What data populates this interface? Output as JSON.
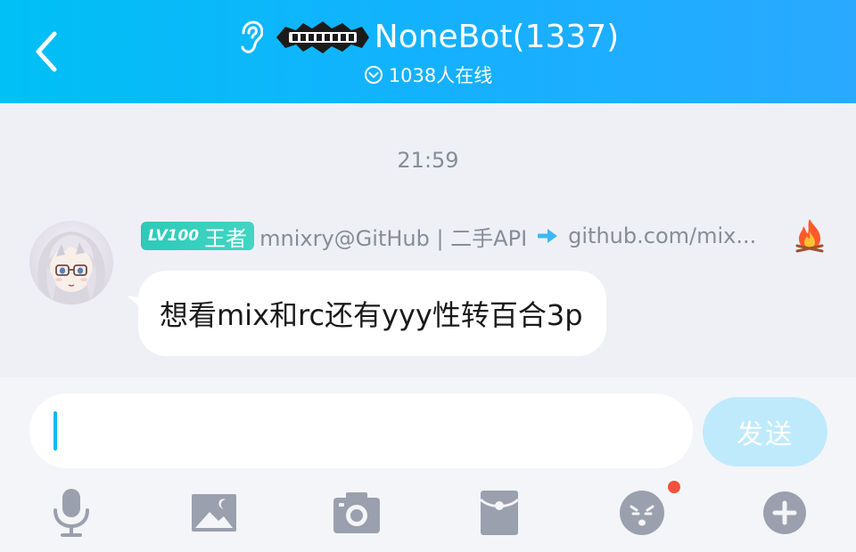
{
  "header": {
    "back_icon": "chevron-left-icon",
    "listen_icon": "ear-icon",
    "logo_icon": "group-logo-icon",
    "title": "NoneBot(1337)",
    "online_icon": "circle-chevron-down-icon",
    "online_text": "1038人在线",
    "color": "#12b7f5"
  },
  "chat": {
    "timestamp": "21:59",
    "message": {
      "avatar_icon": "anime-avatar",
      "level": "LV100",
      "rank": "王者",
      "sender": "mnixry@GitHub | 二手API",
      "arrow_icon": "arrow-right-icon",
      "link": "github.com/mix...",
      "flame_icon": "fire-icon",
      "text": "想看mix和rc还有yyy性转百合3p"
    }
  },
  "input": {
    "value": "",
    "send_label": "发送"
  },
  "toolbar": {
    "items": [
      {
        "icon": "microphone-icon"
      },
      {
        "icon": "image-icon"
      },
      {
        "icon": "camera-icon"
      },
      {
        "icon": "red-packet-icon"
      },
      {
        "icon": "emoji-icon",
        "badge": true
      },
      {
        "icon": "plus-icon"
      }
    ]
  },
  "colors": {
    "header_start": "#00c0f5",
    "header_end": "#2aa9ff",
    "badge": "#2ec9b8",
    "send_disabled": "#bfeafc",
    "caret": "#12b7f5",
    "notify_dot": "#f5503b",
    "toolbar_icon": "#9aa0ad"
  }
}
